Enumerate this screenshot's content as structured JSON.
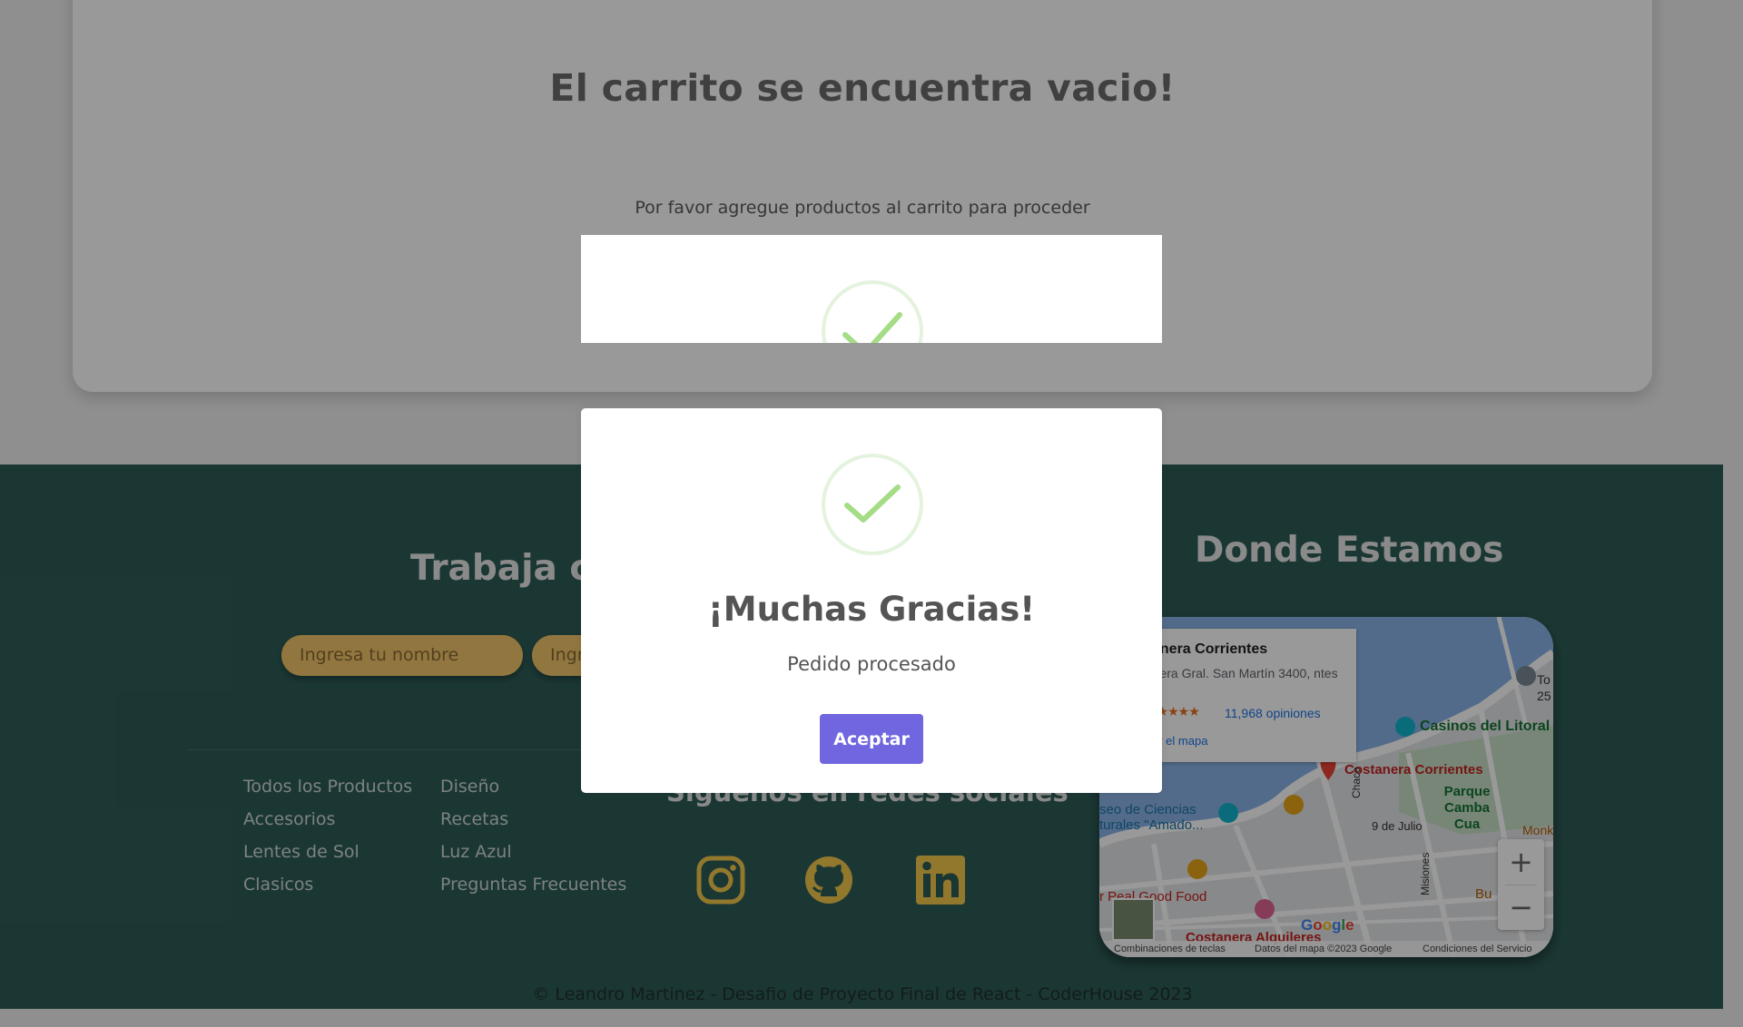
{
  "cart": {
    "title": "El carrito se encuentra vacio!",
    "subtitle": "Por favor agregue productos al carrito para proceder"
  },
  "footer": {
    "work_title": "Trabaja co",
    "name_placeholder": "Ingresa tu nombre",
    "email_placeholder": "Ingr",
    "links_col1": [
      "Todos los Productos",
      "Accesorios",
      "Lentes de Sol",
      "Clasicos"
    ],
    "links_col2": [
      "Diseño",
      "Recetas",
      "Luz Azul",
      "Preguntas Frecuentes"
    ],
    "social_title": "Siguenos en redes sociales",
    "social_icons": [
      "instagram-icon",
      "github-icon",
      "linkedin-icon"
    ],
    "where_title": "Donde Estamos",
    "copyright": "© Leandro Martinez - Desafio de Proyecto Final de React - CoderHouse 2023"
  },
  "map": {
    "place_name": "anera Corrientes",
    "address": "stanera Gral. San Martín 3400, ntes",
    "stars": "★★★★★",
    "reviews": "11,968 opiniones",
    "view_map": "ar el mapa",
    "labels": [
      "Casinos del Litoral",
      "Costanera Corrientes",
      "Parque Camba Cua",
      "9 de Julio",
      "Chaco",
      "Misiones",
      "seo de Ciencias turales \"Amado...",
      "r Peal Good Food",
      "Costanera Alquileres",
      "Monk",
      "Bu",
      "To 25"
    ],
    "zoom_in": "+",
    "zoom_out": "−",
    "google": "Google",
    "bottom_keyboard": "Combinaciones de teclas",
    "bottom_data": "Datos del mapa ©2023 Google",
    "bottom_terms": "Condiciones del Servicio"
  },
  "modal": {
    "title": "¡Muchas Gracias!",
    "text": "Pedido procesado",
    "button": "Aceptar"
  },
  "colors": {
    "footer_bg": "#2e5d58",
    "input_bg": "#f2c66a",
    "icon_color": "#f2c94c",
    "button_bg": "#7066e0",
    "check_color": "#a5dc86"
  }
}
